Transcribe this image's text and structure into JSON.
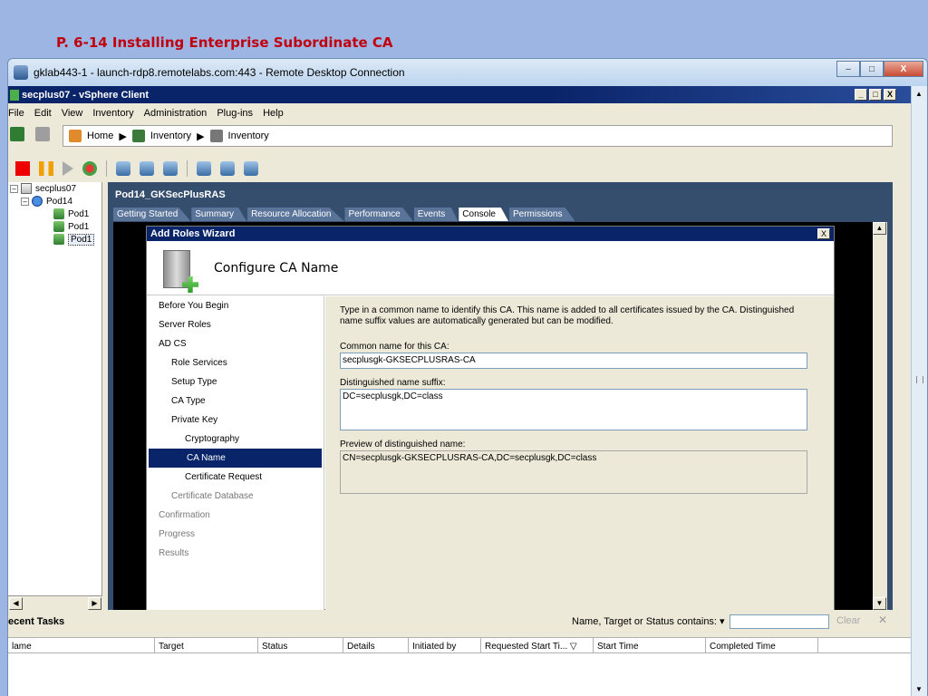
{
  "slide": {
    "title": "P. 6-14 Installing Enterprise Subordinate CA"
  },
  "rdp": {
    "title": "gklab443-1 - launch-rdp8.remotelabs.com:443 - Remote Desktop Connection",
    "btn_min": "–",
    "btn_max": "□",
    "btn_close": "X"
  },
  "vsphere": {
    "title": "secplus07 - vSphere Client",
    "win_min": "_",
    "win_max": "□",
    "win_close": "X",
    "menu": [
      "File",
      "Edit",
      "View",
      "Inventory",
      "Administration",
      "Plug-ins",
      "Help"
    ],
    "nav": [
      "Home",
      "Inventory",
      "Inventory"
    ],
    "tree": [
      {
        "label": "secplus07",
        "level": 0,
        "exp": "–",
        "icon": "host-icon"
      },
      {
        "label": "Pod14",
        "level": 1,
        "exp": "–",
        "icon": "datacenter-icon"
      },
      {
        "label": "Pod1",
        "level": 2,
        "icon": "vm-icon"
      },
      {
        "label": "Pod1",
        "level": 2,
        "icon": "vm-icon"
      },
      {
        "label": "Pod1",
        "level": 2,
        "icon": "vm-icon",
        "selected": true
      }
    ],
    "pane_title": "Pod14_GKSecPlusRAS",
    "tabs": [
      "Getting Started",
      "Summary",
      "Resource Allocation",
      "Performance",
      "Events",
      "Console",
      "Permissions"
    ],
    "active_tab": "Console"
  },
  "wizard": {
    "title": "Add Roles Wizard",
    "close": "X",
    "heading": "Configure CA Name",
    "steps": [
      {
        "label": "Before You Begin",
        "level": 0
      },
      {
        "label": "Server Roles",
        "level": 0
      },
      {
        "label": "AD CS",
        "level": 0
      },
      {
        "label": "Role Services",
        "level": 1
      },
      {
        "label": "Setup Type",
        "level": 1
      },
      {
        "label": "CA Type",
        "level": 1
      },
      {
        "label": "Private Key",
        "level": 1
      },
      {
        "label": "Cryptography",
        "level": 2
      },
      {
        "label": "CA Name",
        "level": 2,
        "active": true
      },
      {
        "label": "Certificate Request",
        "level": 2
      },
      {
        "label": "Certificate Database",
        "level": 1,
        "dim": true
      },
      {
        "label": "Confirmation",
        "level": 0,
        "dim": true
      },
      {
        "label": "Progress",
        "level": 0,
        "dim": true
      },
      {
        "label": "Results",
        "level": 0,
        "dim": true
      }
    ],
    "description": "Type in a common name to identify this CA. This name is added to all certificates issued by the CA. Distinguished name suffix values are automatically generated but can be modified.",
    "common_name_label": "Common name for this CA:",
    "common_name_value": "secplusgk-GKSECPLUSRAS-CA",
    "dn_suffix_label": "Distinguished name suffix:",
    "dn_suffix_value": "DC=secplusgk,DC=class",
    "preview_label": "Preview of distinguished name:",
    "preview_value": "CN=secplusgk-GKSECPLUSRAS-CA,DC=secplusgk,DC=class"
  },
  "tasks": {
    "title": "ecent Tasks",
    "filter_label": "Name, Target or Status contains: ▾",
    "clear": "Clear",
    "close": "✕",
    "columns": [
      "lame",
      "Target",
      "Status",
      "Details",
      "Initiated by",
      "Requested Start Ti... ▽",
      "Start Time",
      "Completed Time"
    ]
  }
}
